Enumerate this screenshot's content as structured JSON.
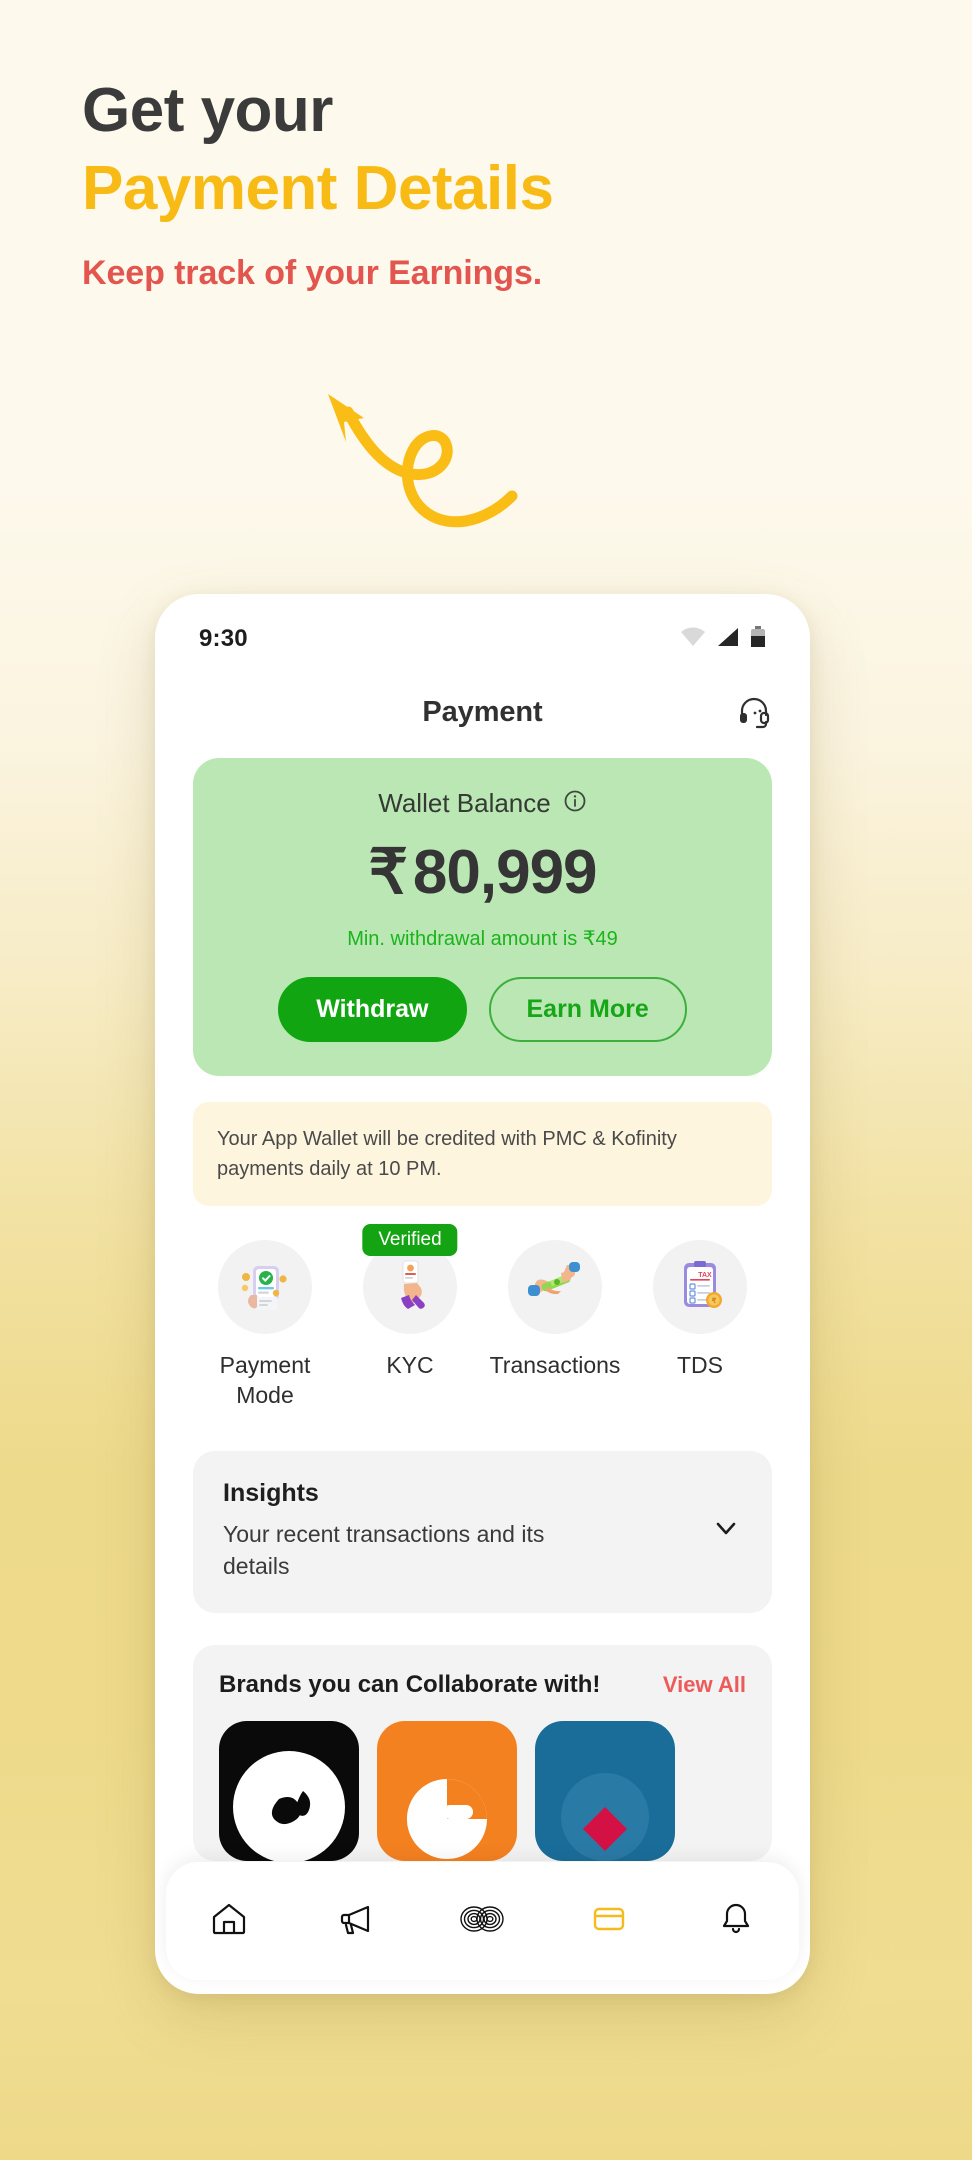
{
  "promo": {
    "headline_line1": "Get your",
    "headline_line2": "Payment Details",
    "tagline": "Keep track of your Earnings.",
    "colors": {
      "headline_dark": "#3b3b3b",
      "headline_accent": "#f8bb15",
      "tagline": "#e2564f",
      "background_top": "#fdf9ec",
      "background_bottom": "#eeda8a",
      "arrow": "#f9bd16"
    }
  },
  "phone": {
    "status_bar": {
      "time": "9:30",
      "icons": [
        "wifi-icon",
        "cellular-signal-icon",
        "battery-icon"
      ]
    },
    "header": {
      "title": "Payment",
      "support_icon": "headset-support-icon"
    },
    "wallet_card": {
      "label": "Wallet Balance",
      "info_icon": "info-icon",
      "currency": "₹",
      "amount": "80,999",
      "min_withdrawal": "Min. withdrawal amount is ₹49",
      "primary_button": "Withdraw",
      "secondary_button": "Earn More",
      "bg_color": "#bbe7b5",
      "primary_color": "#11a611"
    },
    "notice": "Your App Wallet will be credited with PMC & Kofinity payments daily at 10 PM.",
    "actions": [
      {
        "label": "Payment Mode",
        "icon": "payment-mode-icon",
        "badge": null
      },
      {
        "label": "KYC",
        "icon": "kyc-icon",
        "badge": "Verified"
      },
      {
        "label": "Transactions",
        "icon": "transactions-icon",
        "badge": null
      },
      {
        "label": "TDS",
        "icon": "tds-icon",
        "badge": null
      }
    ],
    "insights": {
      "title": "Insights",
      "subtitle": "Your recent transactions and its details",
      "chevron_icon": "chevron-down-icon"
    },
    "brands": {
      "title": "Brands you can Collaborate with!",
      "view_all": "View All",
      "tiles": [
        {
          "name": "brand-tile-black",
          "bg": "#0a0a0a"
        },
        {
          "name": "brand-tile-orange",
          "bg": "#f48120"
        },
        {
          "name": "brand-tile-blue",
          "bg": "#1a6d99"
        }
      ]
    },
    "bottom_nav": [
      {
        "icon": "home-icon",
        "active": false
      },
      {
        "icon": "megaphone-icon",
        "active": false
      },
      {
        "icon": "infinity-loops-icon",
        "active": false
      },
      {
        "icon": "wallet-card-icon",
        "active": true
      },
      {
        "icon": "bell-icon",
        "active": false
      }
    ],
    "nav_active_color": "#f5bb1c"
  }
}
